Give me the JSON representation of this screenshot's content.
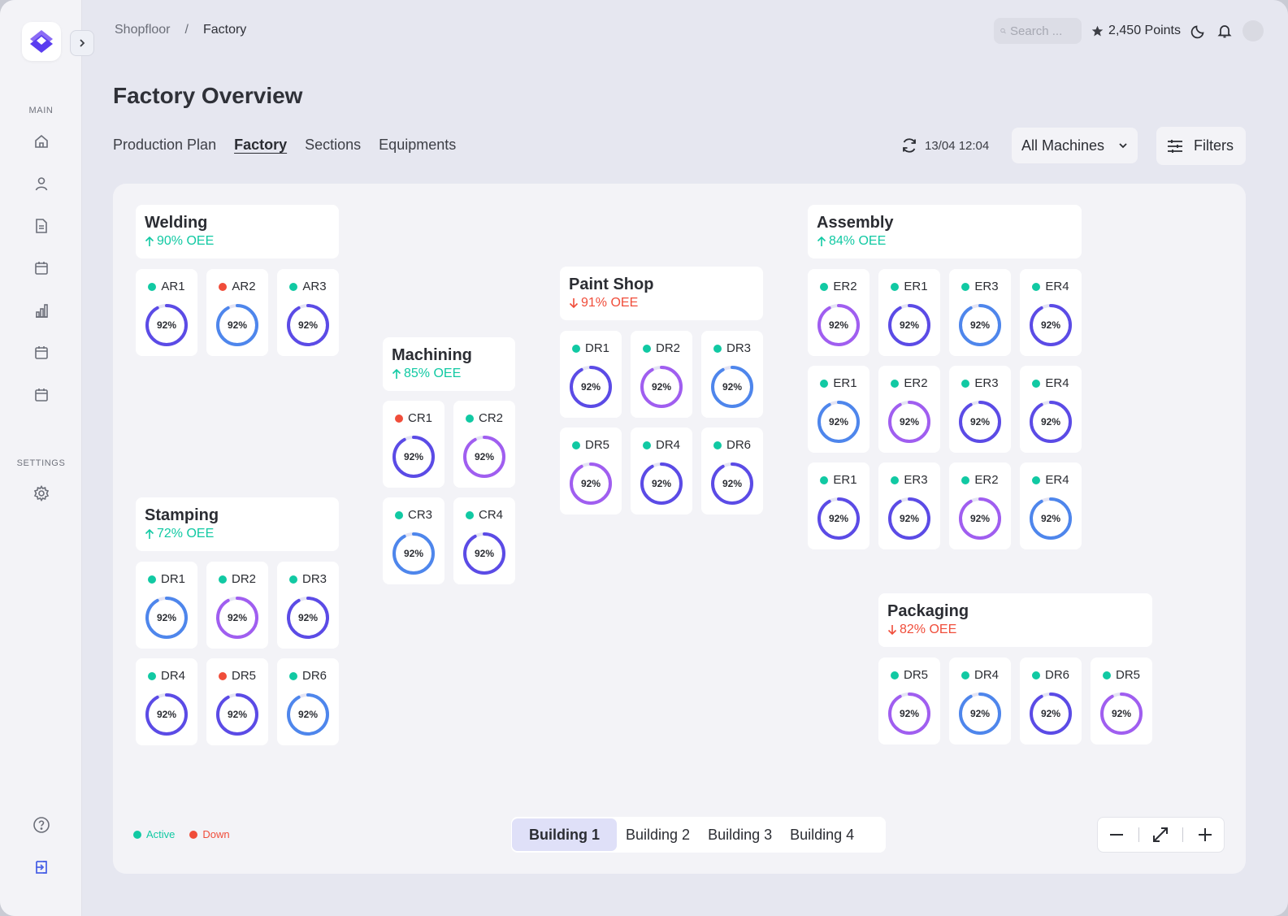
{
  "breadcrumb": {
    "parent": "Shopfloor",
    "separator": "/",
    "current": "Factory"
  },
  "header": {
    "search_placeholder": "Search ...",
    "points": "2,450 Points"
  },
  "sidebar": {
    "main_label": "MAIN",
    "settings_label": "SETTINGS"
  },
  "page": {
    "title": "Factory Overview"
  },
  "tabs": [
    "Production Plan",
    "Factory",
    "Sections",
    "Equipments"
  ],
  "active_tab": "Factory",
  "toolbar": {
    "sync_time": "13/04 12:04",
    "machine_filter": "All Machines",
    "filters_label": "Filters"
  },
  "colors": {
    "active": "#11c9a3",
    "down": "#f04d3a",
    "accent": "#6c4ef2"
  },
  "groups": [
    {
      "name": "Welding",
      "oee": "90% OEE",
      "trend": "up",
      "machines": [
        {
          "id": "AR1",
          "status": "active",
          "value": "92%",
          "ring": "indigo"
        },
        {
          "id": "AR2",
          "status": "down",
          "value": "92%",
          "ring": "blue"
        },
        {
          "id": "AR3",
          "status": "active",
          "value": "92%",
          "ring": "indigo"
        }
      ]
    },
    {
      "name": "Stamping",
      "oee": "72% OEE",
      "trend": "up",
      "machines": [
        {
          "id": "DR1",
          "status": "active",
          "value": "92%",
          "ring": "blue"
        },
        {
          "id": "DR2",
          "status": "active",
          "value": "92%",
          "ring": "purple"
        },
        {
          "id": "DR3",
          "status": "active",
          "value": "92%",
          "ring": "indigo"
        },
        {
          "id": "DR4",
          "status": "active",
          "value": "92%",
          "ring": "indigo"
        },
        {
          "id": "DR5",
          "status": "down",
          "value": "92%",
          "ring": "indigo"
        },
        {
          "id": "DR6",
          "status": "active",
          "value": "92%",
          "ring": "blue"
        }
      ]
    },
    {
      "name": "Machining",
      "oee": "85% OEE",
      "trend": "up",
      "machines": [
        {
          "id": "CR1",
          "status": "down",
          "value": "92%",
          "ring": "indigo"
        },
        {
          "id": "CR2",
          "status": "active",
          "value": "92%",
          "ring": "purple"
        },
        {
          "id": "CR3",
          "status": "active",
          "value": "92%",
          "ring": "blue"
        },
        {
          "id": "CR4",
          "status": "active",
          "value": "92%",
          "ring": "indigo"
        }
      ]
    },
    {
      "name": "Paint Shop",
      "oee": "91% OEE",
      "trend": "down",
      "machines": [
        {
          "id": "DR1",
          "status": "active",
          "value": "92%",
          "ring": "indigo"
        },
        {
          "id": "DR2",
          "status": "active",
          "value": "92%",
          "ring": "purple"
        },
        {
          "id": "DR3",
          "status": "active",
          "value": "92%",
          "ring": "blue"
        },
        {
          "id": "DR5",
          "status": "active",
          "value": "92%",
          "ring": "purple"
        },
        {
          "id": "DR4",
          "status": "active",
          "value": "92%",
          "ring": "indigo"
        },
        {
          "id": "DR6",
          "status": "active",
          "value": "92%",
          "ring": "indigo"
        }
      ]
    },
    {
      "name": "Assembly",
      "oee": "84% OEE",
      "trend": "up",
      "machines": [
        {
          "id": "ER2",
          "status": "active",
          "value": "92%",
          "ring": "purple"
        },
        {
          "id": "ER1",
          "status": "active",
          "value": "92%",
          "ring": "indigo"
        },
        {
          "id": "ER3",
          "status": "active",
          "value": "92%",
          "ring": "blue"
        },
        {
          "id": "ER4",
          "status": "active",
          "value": "92%",
          "ring": "indigo"
        },
        {
          "id": "ER1",
          "status": "active",
          "value": "92%",
          "ring": "blue"
        },
        {
          "id": "ER2",
          "status": "active",
          "value": "92%",
          "ring": "purple"
        },
        {
          "id": "ER3",
          "status": "active",
          "value": "92%",
          "ring": "indigo"
        },
        {
          "id": "ER4",
          "status": "active",
          "value": "92%",
          "ring": "indigo"
        },
        {
          "id": "ER1",
          "status": "active",
          "value": "92%",
          "ring": "indigo"
        },
        {
          "id": "ER3",
          "status": "active",
          "value": "92%",
          "ring": "indigo"
        },
        {
          "id": "ER2",
          "status": "active",
          "value": "92%",
          "ring": "purple"
        },
        {
          "id": "ER4",
          "status": "active",
          "value": "92%",
          "ring": "blue"
        }
      ]
    },
    {
      "name": "Packaging",
      "oee": "82% OEE",
      "trend": "down",
      "machines": [
        {
          "id": "DR5",
          "status": "active",
          "value": "92%",
          "ring": "purple"
        },
        {
          "id": "DR4",
          "status": "active",
          "value": "92%",
          "ring": "blue"
        },
        {
          "id": "DR6",
          "status": "active",
          "value": "92%",
          "ring": "indigo"
        },
        {
          "id": "DR5",
          "status": "active",
          "value": "92%",
          "ring": "purple"
        }
      ]
    }
  ],
  "legend": {
    "active": "Active",
    "down": "Down"
  },
  "buildings": [
    "Building 1",
    "Building 2",
    "Building 3",
    "Building 4"
  ],
  "active_building": "Building 1"
}
